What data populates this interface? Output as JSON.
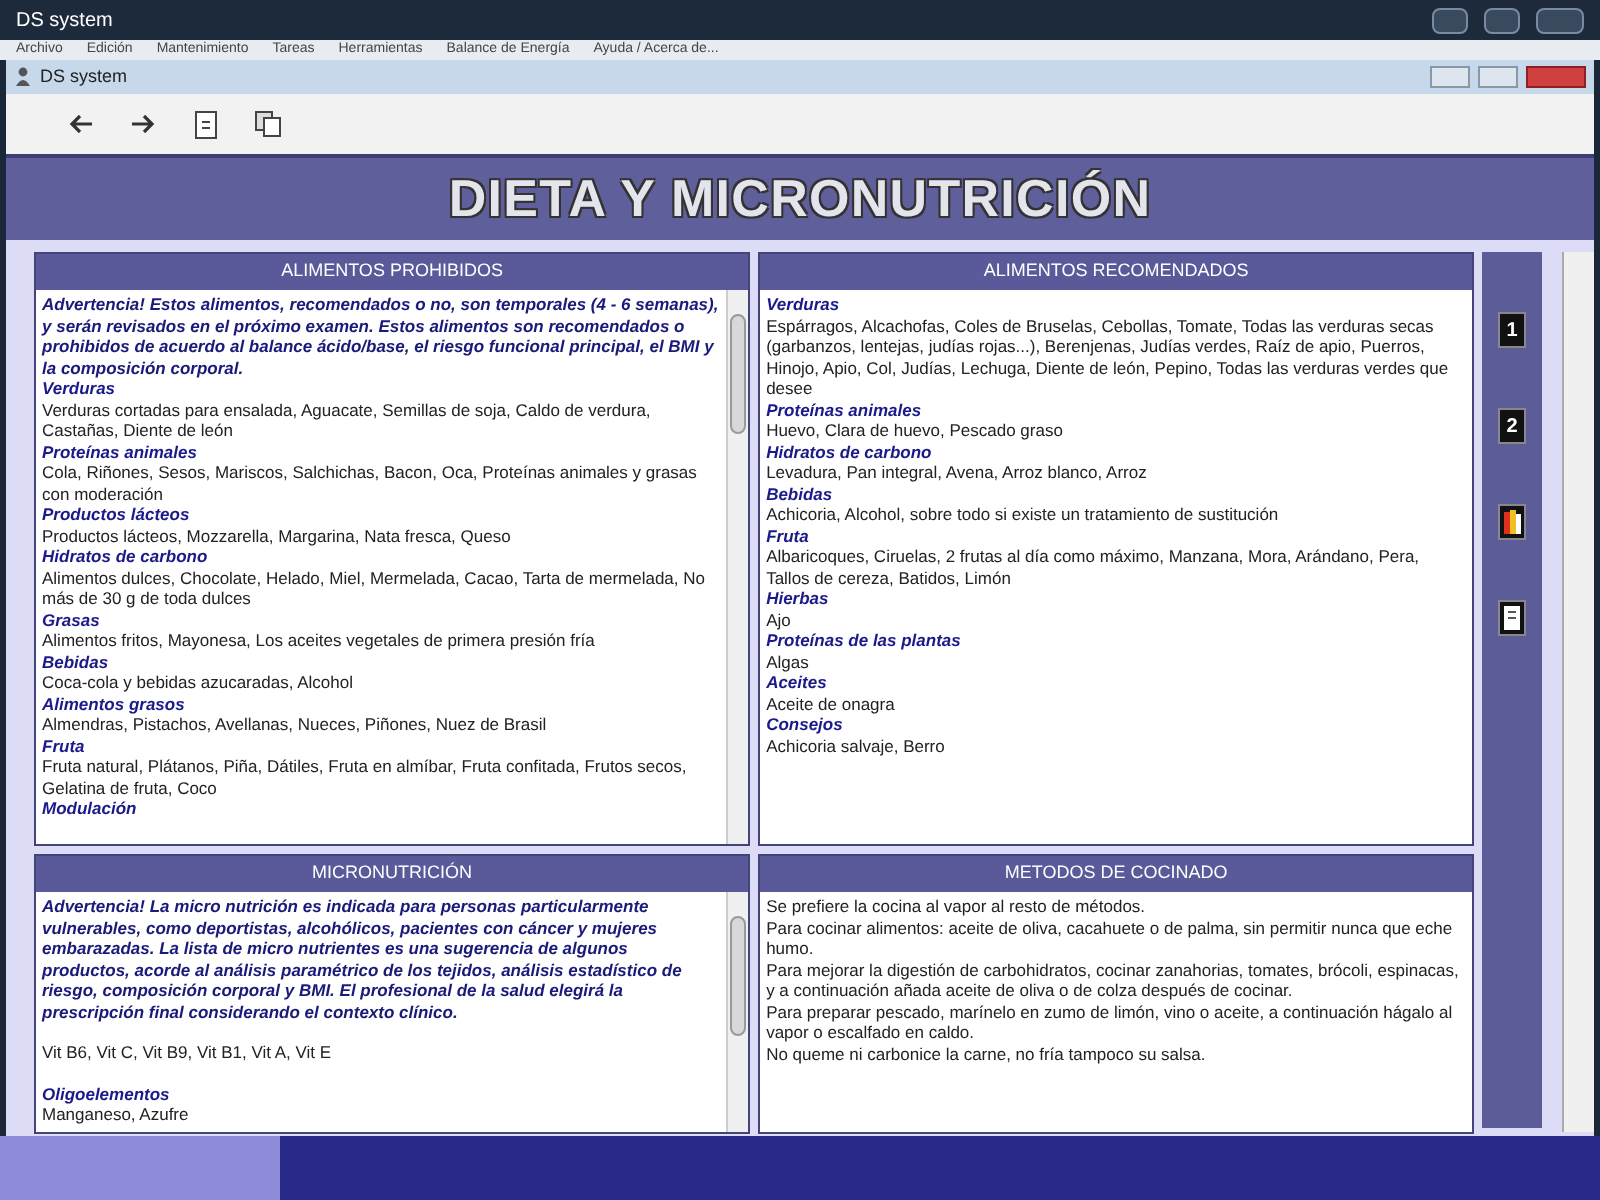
{
  "app_window": {
    "title": "DS system"
  },
  "menu": [
    "Archivo",
    "Edición",
    "Mantenimiento",
    "Tareas",
    "Herramientas",
    "Balance de Energía",
    "Ayuda / Acerca de..."
  ],
  "window": {
    "title": "DS system"
  },
  "page_title": "DIETA Y MICRONUTRICIÓN",
  "panels": [
    {
      "title": "ALIMENTOS PROHIBIDOS",
      "scrollable": true,
      "blocks": [
        {
          "kind": "warning",
          "text": "Advertencia! Estos alimentos, recomendados o no, son temporales (4 - 6 semanas), y serán revisados en el próximo examen. Estos alimentos son recomendados o prohibidos de acuerdo al balance ácido/base, el riesgo funcional principal, el BMI y la composición corporal."
        },
        {
          "kind": "heading",
          "text": "Verduras"
        },
        {
          "kind": "text",
          "text": "Verduras cortadas para ensalada, Aguacate, Semillas de soja, Caldo de verdura, Castañas, Diente de león"
        },
        {
          "kind": "heading",
          "text": "Proteínas animales"
        },
        {
          "kind": "text",
          "text": "Cola, Riñones, Sesos, Mariscos, Salchichas, Bacon, Oca, Proteínas animales y grasas con moderación"
        },
        {
          "kind": "heading",
          "text": "Productos lácteos"
        },
        {
          "kind": "text",
          "text": "Productos lácteos, Mozzarella, Margarina, Nata fresca, Queso"
        },
        {
          "kind": "heading",
          "text": "Hidratos de carbono"
        },
        {
          "kind": "text",
          "text": "Alimentos dulces, Chocolate, Helado, Miel, Mermelada, Cacao, Tarta de mermelada, No más de 30 g de toda dulces"
        },
        {
          "kind": "heading",
          "text": "Grasas"
        },
        {
          "kind": "text",
          "text": "Alimentos fritos, Mayonesa, Los aceites vegetales de primera presión fría"
        },
        {
          "kind": "heading",
          "text": "Bebidas"
        },
        {
          "kind": "text",
          "text": "Coca-cola y bebidas azucaradas, Alcohol"
        },
        {
          "kind": "heading",
          "text": "Alimentos grasos"
        },
        {
          "kind": "text",
          "text": "Almendras, Pistachos, Avellanas, Nueces, Piñones, Nuez de Brasil"
        },
        {
          "kind": "heading",
          "text": "Fruta"
        },
        {
          "kind": "text",
          "text": "Fruta natural, Plátanos, Piña, Dátiles, Fruta en almíbar, Fruta confitada, Frutos secos, Gelatina de fruta, Coco"
        },
        {
          "kind": "heading",
          "text": "Modulación"
        }
      ]
    },
    {
      "title": "ALIMENTOS RECOMENDADOS",
      "scrollable": false,
      "blocks": [
        {
          "kind": "heading",
          "text": "Verduras"
        },
        {
          "kind": "text",
          "text": "Espárragos, Alcachofas, Coles de Bruselas, Cebollas, Tomate, Todas las verduras secas (garbanzos, lentejas, judías rojas...), Berenjenas, Judías verdes, Raíz de apio, Puerros, Hinojo, Apio, Col, Judías, Lechuga, Diente de león, Pepino, Todas las verduras verdes que desee"
        },
        {
          "kind": "heading",
          "text": "Proteínas animales"
        },
        {
          "kind": "text",
          "text": "Huevo, Clara de huevo, Pescado graso"
        },
        {
          "kind": "heading",
          "text": "Hidratos de carbono"
        },
        {
          "kind": "text",
          "text": "Levadura, Pan integral, Avena, Arroz blanco, Arroz"
        },
        {
          "kind": "heading",
          "text": "Bebidas"
        },
        {
          "kind": "text",
          "text": "Achicoria, Alcohol, sobre todo si existe un tratamiento de sustitución"
        },
        {
          "kind": "heading",
          "text": "Fruta"
        },
        {
          "kind": "text",
          "text": "Albaricoques, Ciruelas, 2 frutas al día como máximo, Manzana, Mora, Arándano, Pera, Tallos de cereza, Batidos, Limón"
        },
        {
          "kind": "heading",
          "text": "Hierbas"
        },
        {
          "kind": "text",
          "text": "Ajo"
        },
        {
          "kind": "heading",
          "text": "Proteínas de las plantas"
        },
        {
          "kind": "text",
          "text": "Algas"
        },
        {
          "kind": "heading",
          "text": "Aceites"
        },
        {
          "kind": "text",
          "text": "Aceite de onagra"
        },
        {
          "kind": "heading",
          "text": "Consejos"
        },
        {
          "kind": "text",
          "text": "Achicoria salvaje, Berro"
        }
      ]
    },
    {
      "title": "MICRONUTRICIÓN",
      "scrollable": true,
      "blocks": [
        {
          "kind": "warning",
          "text": "Advertencia! La micro nutrición es indicada para personas particularmente vulnerables, como deportistas, alcohólicos, pacientes con cáncer y mujeres embarazadas. La lista de micro nutrientes es una sugerencia de algunos productos, acorde al análisis paramétrico de los tejidos, análisis estadístico de riesgo, composición corporal y BMI. El profesional de la salud elegirá la prescripción final considerando el contexto clínico."
        },
        {
          "kind": "spacer"
        },
        {
          "kind": "text",
          "text": "Vit B6, Vit C, Vit B9, Vit B1, Vit A, Vit E"
        },
        {
          "kind": "spacer"
        },
        {
          "kind": "heading",
          "text": "Oligoelementos"
        },
        {
          "kind": "text",
          "text": "Manganeso, Azufre"
        }
      ]
    },
    {
      "title": "METODOS DE COCINADO",
      "scrollable": false,
      "blocks": [
        {
          "kind": "text",
          "text": "Se prefiere la cocina al vapor al resto de métodos."
        },
        {
          "kind": "text",
          "text": "Para cocinar alimentos: aceite de oliva, cacahuete o de palma, sin permitir nunca que eche humo."
        },
        {
          "kind": "text",
          "text": "Para mejorar la digestión de carbohidratos, cocinar zanahorias, tomates, brócoli, espinacas, y a continuación añada aceite de oliva o de colza después de cocinar."
        },
        {
          "kind": "text",
          "text": "Para preparar pescado, marínelo en zumo de limón, vino o aceite, a continuación hágalo al vapor o escalfado en caldo."
        },
        {
          "kind": "text",
          "text": "No queme ni carbonice la carne, no fría tampoco su salsa."
        }
      ]
    }
  ],
  "side_buttons": [
    {
      "kind": "number",
      "label": "1"
    },
    {
      "kind": "number",
      "label": "2"
    },
    {
      "kind": "books"
    },
    {
      "kind": "book"
    }
  ]
}
